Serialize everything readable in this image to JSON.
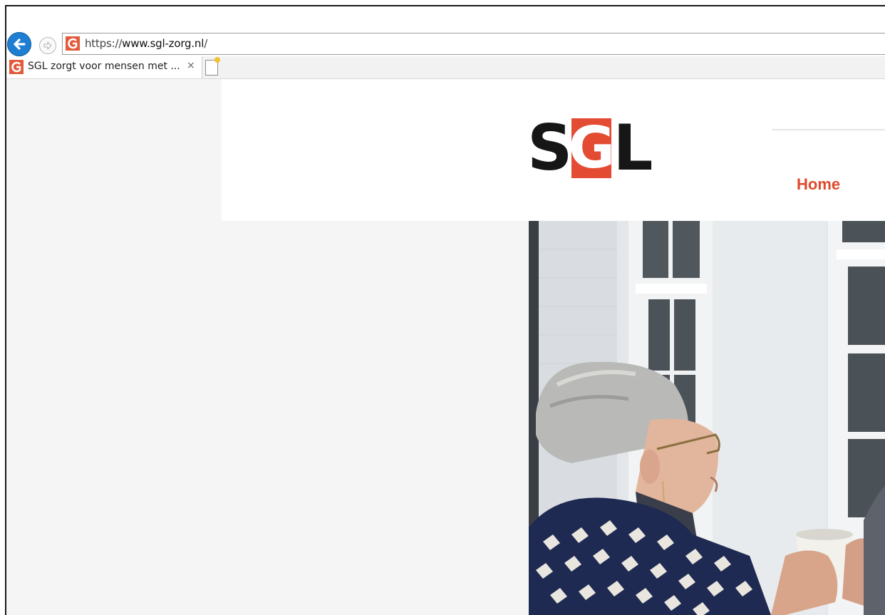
{
  "browser": {
    "back_icon": "back-arrow-icon",
    "forward_icon": "forward-arrow-icon",
    "address": {
      "favicon": "sgl-favicon-icon",
      "scheme": "https://",
      "host": "www.sgl-zorg.nl",
      "path": "/"
    },
    "tabs": [
      {
        "title": "SGL zorgt voor mensen met ...",
        "close_glyph": "×",
        "active": true
      }
    ],
    "new_tab_icon": "new-tab-icon"
  },
  "site": {
    "logo": {
      "letters": [
        "S",
        "G",
        "L"
      ],
      "accent_color": "#e34b33",
      "dark_color": "#161616"
    },
    "nav": {
      "home_label": "Home",
      "home_color": "#df4a2d"
    },
    "hero_image": "hero-photo-elderly-woman-with-cup"
  }
}
